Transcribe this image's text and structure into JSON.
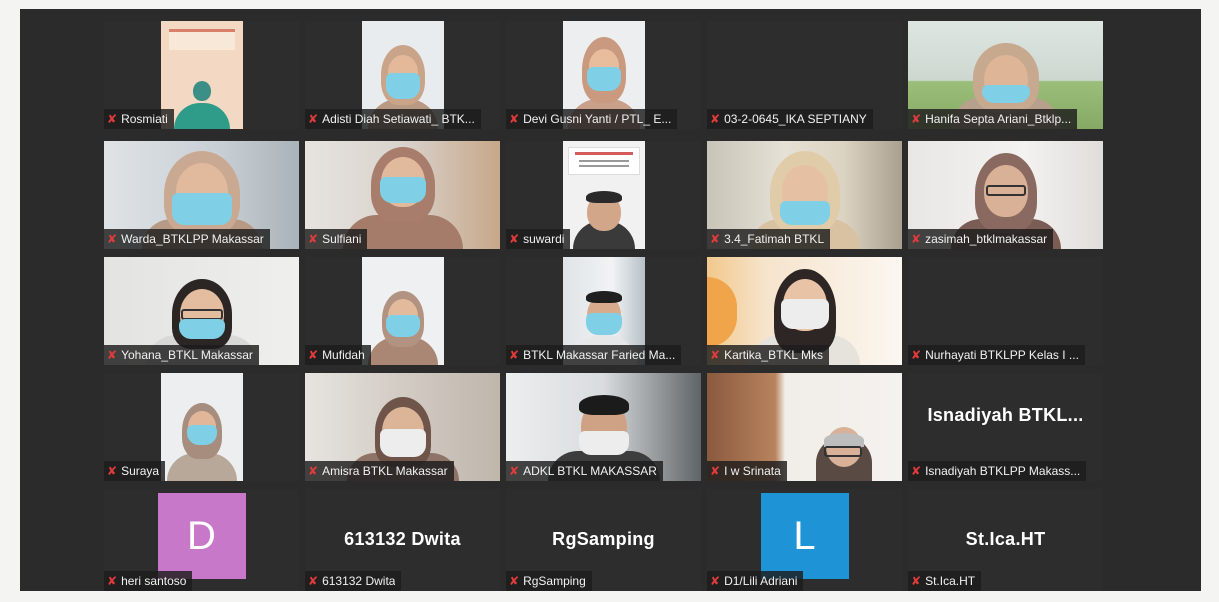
{
  "participants": [
    {
      "name": "Rosmiati"
    },
    {
      "name": "Adisti Diah Setiawati_ BTK..."
    },
    {
      "name": "Devi Gusni Yanti / PTL_ E..."
    },
    {
      "name": "03-2-0645_IKA SEPTIANY"
    },
    {
      "name": "Hanifa Septa Ariani_Btklp..."
    },
    {
      "name": "Warda_BTKLPP Makassar"
    },
    {
      "name": "Sulfiani"
    },
    {
      "name": "suwardi"
    },
    {
      "name": "3.4_Fatimah BTKL"
    },
    {
      "name": "zasimah_btklmakassar"
    },
    {
      "name": "Yohana_BTKL Makassar"
    },
    {
      "name": "Mufidah"
    },
    {
      "name": "BTKL Makassar Faried Ma..."
    },
    {
      "name": "Kartika_BTKL Mks"
    },
    {
      "name": "Nurhayati BTKLPP Kelas I ..."
    },
    {
      "name": "Suraya"
    },
    {
      "name": "Amisra BTKL Makassar"
    },
    {
      "name": "ADKL BTKL MAKASSAR"
    },
    {
      "name": "I w Srinata"
    },
    {
      "name": "Isnadiyah BTKLPP Makass...",
      "display": "Isnadiyah  BTKL..."
    },
    {
      "name": "heri santoso",
      "avatar": "D"
    },
    {
      "name": "613132 Dwita",
      "display": "613132 Dwita"
    },
    {
      "name": "RgSamping",
      "display": "RgSamping"
    },
    {
      "name": "D1/Lili Adriani",
      "avatar": "L"
    },
    {
      "name": "St.Ica.HT",
      "display": "St.Ica.HT"
    }
  ],
  "icons": {
    "muted": "muted-mic-icon"
  },
  "colors": {
    "gallery_bg": "#2b2b2b",
    "muted_red": "#e23b3b",
    "avatar_pink": "#c878c9",
    "avatar_blue": "#1e94d6"
  }
}
